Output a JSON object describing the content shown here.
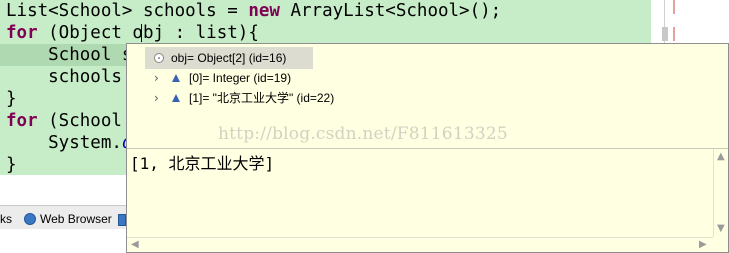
{
  "editor": {
    "lines": [
      {
        "segments": [
          [
            "",
            "List<School> schools = "
          ],
          [
            "kw",
            "new"
          ],
          [
            "",
            " ArrayList<School>();"
          ]
        ]
      },
      {
        "segments": [
          [
            "kw",
            "for"
          ],
          [
            "",
            " (Object obj : list){"
          ]
        ]
      },
      {
        "segments": [
          [
            "",
            "    School s"
          ]
        ]
      },
      {
        "segments": [
          [
            "",
            "    schools."
          ]
        ]
      },
      {
        "segments": [
          [
            "",
            "}"
          ]
        ]
      },
      {
        "segments": [
          [
            "kw",
            "for"
          ],
          [
            "",
            " (School"
          ]
        ]
      },
      {
        "segments": [
          [
            "",
            "    System."
          ],
          [
            "it",
            "o"
          ]
        ]
      },
      {
        "segments": [
          [
            "",
            "}"
          ]
        ]
      }
    ]
  },
  "tabs": {
    "partial_label": "ks",
    "web_browser_label": "Web Browser"
  },
  "popup": {
    "root_label": "obj= Object[2]  (id=16)",
    "child0_label": "[0]= Integer  (id=19)",
    "child1_label": "[1]= \"北京工业大学\" (id=22)",
    "watermark": "http://blog.csdn.net/F811613325",
    "detail_value": "[1, 北京工业大学]"
  },
  "icons": {
    "variable_icon": "circle-variable-icon",
    "field_icon": "blue-triangle-field-icon",
    "expand_icon": "chevron-right-icon",
    "web_browser_icon": "globe-icon"
  }
}
